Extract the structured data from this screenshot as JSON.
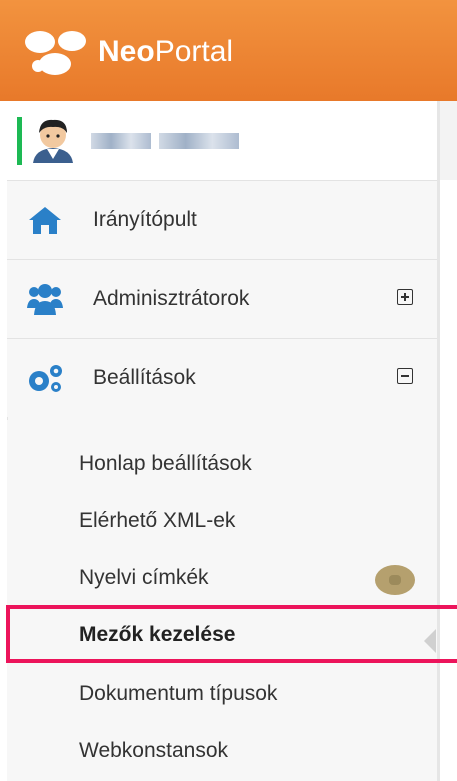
{
  "header": {
    "brand_bold": "Neo",
    "brand_light": "Portal",
    "color": "#ea7d2e"
  },
  "user": {
    "icon": "user-avatar-icon",
    "accent_color": "#1db954"
  },
  "menu": [
    {
      "label": "Irányítópult",
      "icon": "home-icon"
    },
    {
      "label": "Adminisztrátorok",
      "icon": "users-icon",
      "toggle": "plus"
    },
    {
      "label": "Beállítások",
      "icon": "gears-icon",
      "toggle": "minus"
    }
  ],
  "submenu": [
    {
      "label": "Honlap beállítások"
    },
    {
      "label": "Elérhető XML-ek"
    },
    {
      "label": "Nyelvi címkék"
    },
    {
      "label": "Mezők kezelése",
      "active": true
    },
    {
      "label": "Dokumentum típusok"
    },
    {
      "label": "Webkonstansok"
    }
  ],
  "highlight_color": "#ec145b"
}
